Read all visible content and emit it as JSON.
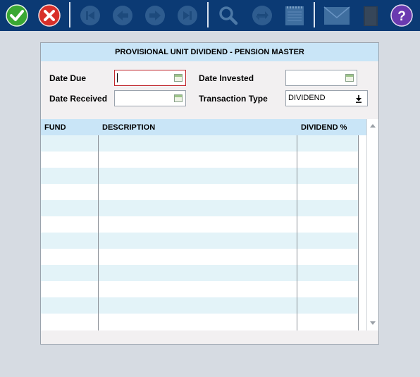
{
  "toolbar": {
    "buttons": [
      {
        "name": "accept",
        "icon": "check-icon",
        "color": "#3aa833"
      },
      {
        "name": "cancel",
        "icon": "close-icon",
        "color": "#d8302a"
      },
      {
        "name": "first",
        "icon": "first-record-icon"
      },
      {
        "name": "previous",
        "icon": "arrow-left-icon"
      },
      {
        "name": "next",
        "icon": "arrow-right-icon"
      },
      {
        "name": "last",
        "icon": "last-record-icon"
      },
      {
        "name": "search",
        "icon": "search-icon"
      },
      {
        "name": "refresh",
        "icon": "refresh-icon"
      },
      {
        "name": "notes",
        "icon": "notepad-icon"
      },
      {
        "name": "mail",
        "icon": "mail-icon"
      },
      {
        "name": "document",
        "icon": "document-icon"
      },
      {
        "name": "help",
        "icon": "help-icon",
        "color": "#6a3ab0"
      }
    ]
  },
  "form": {
    "title": "PROVISIONAL UNIT DIVIDEND - PENSION MASTER",
    "date_due_label": "Date Due",
    "date_due_value": "",
    "date_invested_label": "Date Invested",
    "date_invested_value": "",
    "date_received_label": "Date Received",
    "date_received_value": "",
    "transaction_type_label": "Transaction Type",
    "transaction_type_value": "DIVIDEND"
  },
  "grid": {
    "columns": [
      "FUND",
      "DESCRIPTION",
      "DIVIDEND %"
    ],
    "rows": []
  },
  "colors": {
    "toolbar_bg": "#0b3a74",
    "header_bg": "#c9e5f7",
    "row_alt_bg": "#e3f3f8",
    "active_border": "#c0272d"
  }
}
